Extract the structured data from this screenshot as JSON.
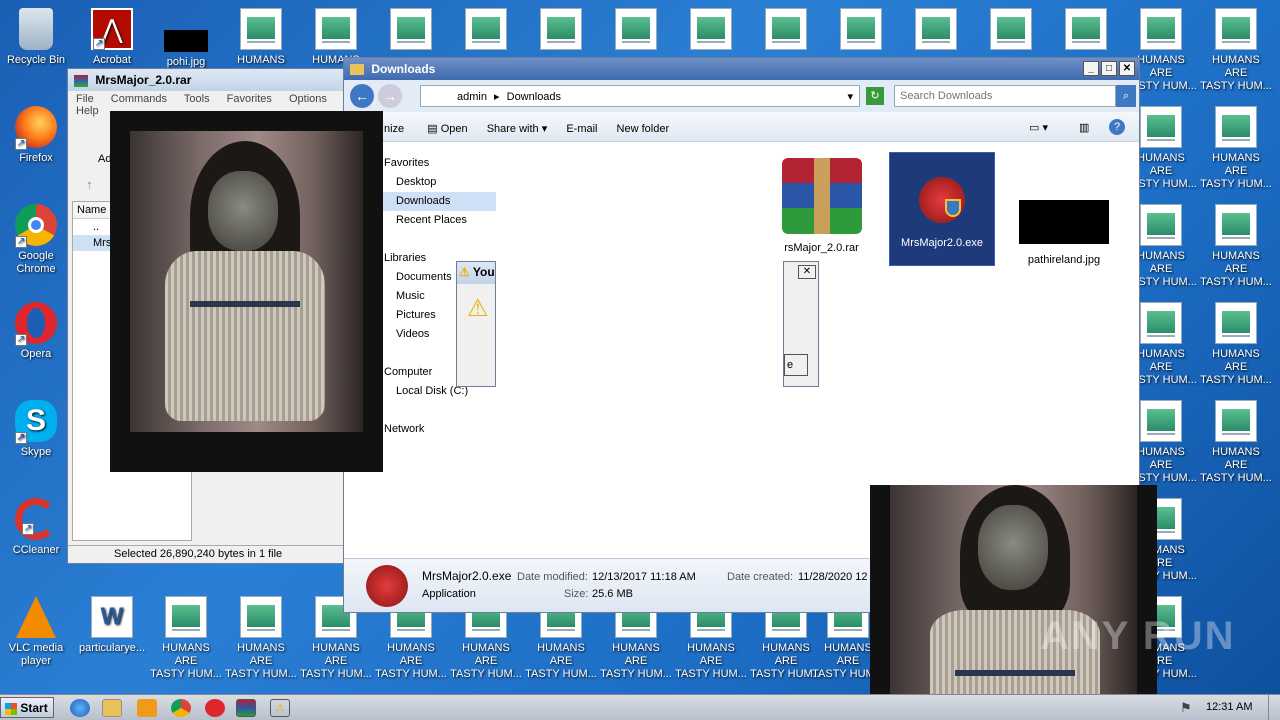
{
  "desktop": {
    "left_icons": [
      {
        "label": "Recycle Bin",
        "icon": "recycle-bin-icon"
      },
      {
        "label": "Firefox",
        "icon": "firefox-icon"
      },
      {
        "label": "Google Chrome",
        "icon": "chrome-icon"
      },
      {
        "label": "Opera",
        "icon": "opera-icon"
      },
      {
        "label": "Skype",
        "icon": "skype-icon"
      },
      {
        "label": "CCleaner",
        "icon": "ccleaner-icon"
      },
      {
        "label": "VLC media player",
        "icon": "vlc-icon"
      }
    ],
    "top_icons": [
      {
        "label": "Acrobat",
        "icon": "acrobat-icon"
      },
      {
        "label": "pohi.jpg",
        "icon": "image-file-icon"
      }
    ],
    "humans_label_1": "HUMANS ARE",
    "humans_label_2": "TASTY HUM...",
    "particular_label": "particularye...",
    "watermark": "ANY RUN"
  },
  "winrar": {
    "title": "MrsMajor_2.0.rar",
    "menu": [
      "File",
      "Commands",
      "Tools",
      "Favorites",
      "Options",
      "Help"
    ],
    "add_label": "Ad",
    "column_name": "Name",
    "row_up": "..",
    "row_file": "Mrs",
    "status": "Selected 26,890,240 bytes in 1 file"
  },
  "explorer": {
    "title": "Downloads",
    "breadcrumb": [
      "admin",
      "Downloads"
    ],
    "search_placeholder": "Search Downloads",
    "toolbar": {
      "organize": "nize",
      "open": "Open",
      "share": "Share with",
      "email": "E-mail",
      "new_folder": "New folder"
    },
    "nav": {
      "favorites": "Favorites",
      "desktop": "Desktop",
      "downloads": "Downloads",
      "recent": "Recent Places",
      "libraries": "Libraries",
      "documents": "Documents",
      "music": "Music",
      "pictures": "Pictures",
      "videos": "Videos",
      "computer": "Computer",
      "local_disk": "Local Disk (C:)",
      "network": "Network"
    },
    "files": [
      {
        "name": "rsMajor_2.0.rar",
        "icon": "winrar-archive-icon"
      },
      {
        "name": "MrsMajor2.0.exe",
        "icon": "exe-app-icon"
      },
      {
        "name": "pathireland.jpg",
        "icon": "image-file-icon"
      }
    ],
    "details": {
      "name": "MrsMajor2.0.exe",
      "type": "Application",
      "modified_label": "Date modified:",
      "modified": "12/13/2017 11:18 AM",
      "created_label": "Date created:",
      "created": "11/28/2020 12",
      "size_label": "Size:",
      "size": "25.6 MB"
    }
  },
  "dialog": {
    "title": "You",
    "button": "e"
  },
  "taskbar": {
    "start": "Start",
    "clock": "12:31 AM"
  }
}
